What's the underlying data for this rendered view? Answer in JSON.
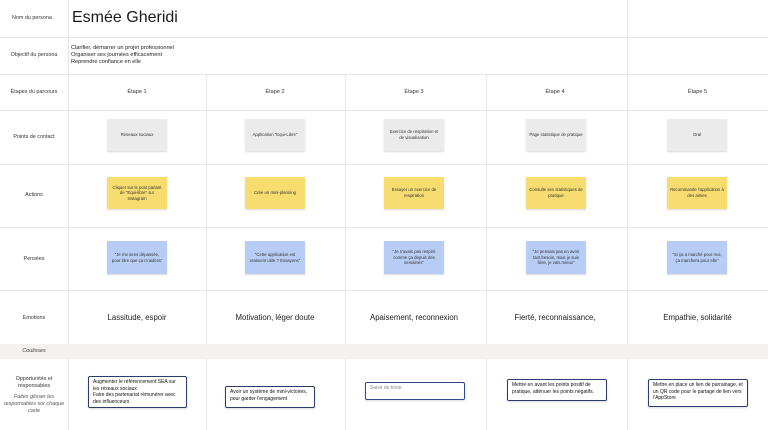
{
  "rows": {
    "persona_name": "Nom du persona",
    "objective": "Objectif du persona",
    "stages": "Étapes du parcours",
    "touchpoints": "Points de contact",
    "actions": "Actions",
    "thoughts": "Pensées",
    "emotions": "Emotions",
    "backstage": "Coulisses",
    "opportunities": "Opportunités et responsables",
    "opportunities_hint": "Faites glisser les responsables sur chaque carte"
  },
  "persona": {
    "name": "Esmée Gheridi",
    "objectives": [
      "Clarifier, démarrer un projet professionnel",
      "Organiser ses journées efficacement",
      "Reprendre confiance en elle"
    ]
  },
  "stages": [
    {
      "title": "Étape 1",
      "touchpoint": "Réseaux sociaux",
      "action": "Cliquer sur le post parlant de \"Equi-libre\" sur Instagram",
      "thought": "\"Je me sens dépassée, pour être que ça m'aidera\"",
      "emotion": "Lassitude, espoir",
      "opportunity": "Augmenter le référencement SEA sur les réseaux sociaux\nFaire des partenariat rémunérer avec des influenceurs"
    },
    {
      "title": "Étape 2",
      "touchpoint": "Application \"Equi-Libre\"",
      "action": "Crée un mini-planning",
      "thought": "\"Cette application est vraiment utile ? Essayons\"",
      "emotion": "Motivation, léger doute",
      "opportunity": "Avoir un système de mini-victoires, pour garder l'engagement"
    },
    {
      "title": "Étape 3",
      "touchpoint": "Exercice de respiration et de visualisation",
      "action": "Essayer un exercice de respiration",
      "thought": "\"Je n'avais pas respiré comme ça depuis des semaines\"",
      "emotion": "Apaisement, reconnexion",
      "opportunity": "Saisir du texte"
    },
    {
      "title": "Étape 4",
      "touchpoint": "Page statistique de pratique",
      "action": "Consulte ses statistiques de pratique",
      "thought": "\"Je pensais pas en avoir tant besoin, mais je suis fière, je vais mieux\"",
      "emotion": "Fierté, reconnaissance,",
      "opportunity": "Mettre en avant les points positif de pratique, atténuer les points négatifs."
    },
    {
      "title": "Étape 5",
      "touchpoint": "Oral",
      "action": "Recommande l'application à des amies",
      "thought": "\"Si ça a marché pour moi, ça marchera pour elle\"",
      "emotion": "Empathie, solidarité",
      "opportunity": "Mettre en place un lien de parrainage, et un QR code pour le partage de lien vers l'AppStore"
    }
  ],
  "colors": {
    "grey_note": "#ebebeb",
    "yellow_note": "#f7dc6f",
    "blue_note": "#b7cdf5",
    "opportunity_border": "#2a3c6c",
    "backstage_band": "#f4f2ee"
  }
}
